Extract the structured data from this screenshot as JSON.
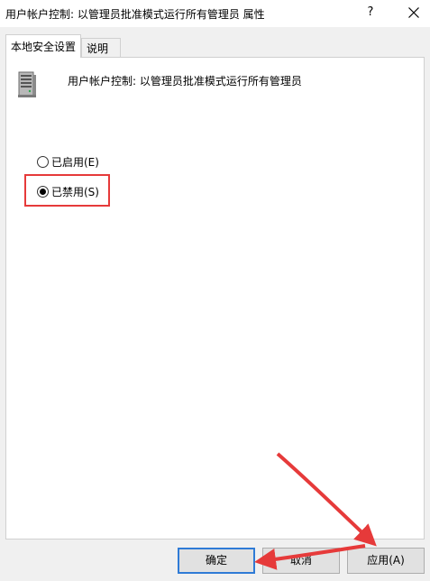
{
  "window": {
    "title": "用户帐户控制: 以管理员批准模式运行所有管理员 属性",
    "help_label": "?"
  },
  "tabs": [
    {
      "label": "本地安全设置",
      "active": true
    },
    {
      "label": "说明",
      "active": false
    }
  ],
  "policy": {
    "icon": "server-icon",
    "title": "用户帐户控制: 以管理员批准模式运行所有管理员"
  },
  "options": [
    {
      "label": "已启用(E)",
      "checked": false
    },
    {
      "label": "已禁用(S)",
      "checked": true
    }
  ],
  "buttons": {
    "ok": "确定",
    "cancel": "取消",
    "apply": "应用(A)"
  },
  "annotation_color": "#e63a3a",
  "accent_color": "#2f7bd6"
}
